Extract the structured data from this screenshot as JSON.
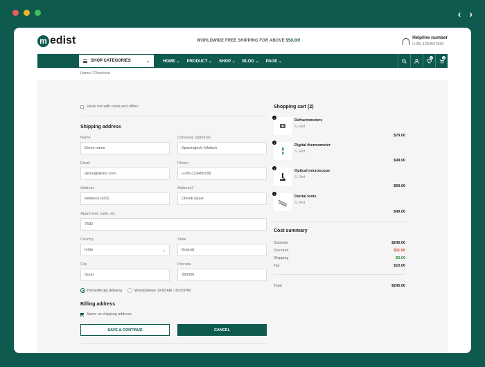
{
  "browser": {
    "prev": "‹",
    "next": "›"
  },
  "colors": {
    "brand": "#0e5a4e",
    "dot_red": "#e85c5c",
    "dot_yellow": "#f0b429",
    "dot_green": "#3dbd5a",
    "discount": "#d93a3a",
    "shipping": "#1a8a3c"
  },
  "header": {
    "logo_initial": "m",
    "logo_text": "edist",
    "promo_text": "WORLDWIDE FREE SHIPPING FOR ABOVE",
    "promo_amount": "$58.00!",
    "helpline_title": "Helpline number",
    "helpline_number": "(+00)-1234567890"
  },
  "nav": {
    "shop_categories": "SHOP CATEGORIES",
    "menu": [
      "HOME",
      "PRODUCT",
      "SHOP",
      "BLOG",
      "PAGE"
    ],
    "icons": [
      "search-icon",
      "user-icon",
      "heart-icon",
      "cart-icon"
    ],
    "wishlist_count": "0",
    "cart_count": "0"
  },
  "breadcrumb": "Home / Checkout",
  "checkout": {
    "newsletter_label": "Email me with news and offers",
    "shipping_title": "Shipping address",
    "fields": {
      "name": {
        "label": "Name",
        "value": "Demo name"
      },
      "company": {
        "label": "Company (optional)",
        "value": "Spacingtech Infotech"
      },
      "email": {
        "label": "Email",
        "value": "demo@demo.com"
      },
      "phone": {
        "label": "Phone",
        "value": "(+20)-123456789"
      },
      "address": {
        "label": "Address",
        "value": "Reliance GIDC"
      },
      "address2": {
        "label": "Address2",
        "value": "Chowk bazar"
      },
      "apartment": {
        "label": "Apartment, suite, etc",
        "value": "7582"
      },
      "country": {
        "label": "Country",
        "value": "India"
      },
      "state": {
        "label": "State",
        "value": "Gujarat"
      },
      "city": {
        "label": "City",
        "value": "Surat"
      },
      "pincode": {
        "label": "Pincode",
        "value": "395006"
      }
    },
    "delivery_home": "Home(All day delivery)",
    "delivery_work": "Work(Delivery 10:00 AM - 05:00 PM)",
    "billing_title": "Billing address",
    "billing_same": "Same as shipping address",
    "save_button": "SAVE & CONTINUE",
    "cancel_button": "CANCEL"
  },
  "cart": {
    "title": "Shopping cart (2)",
    "items": [
      {
        "qty": "1",
        "name": "Refractometers",
        "variant": "S, Red",
        "price": "$79.00"
      },
      {
        "qty": "1",
        "name": "Digital thermometer",
        "variant": "S, Red",
        "price": "$49.00"
      },
      {
        "qty": "1",
        "name": "Optical microscope",
        "variant": "S, Red",
        "price": "$69.00"
      },
      {
        "qty": "1",
        "name": "Dental tools",
        "variant": "S, Red",
        "price": "$49.00"
      }
    ]
  },
  "summary": {
    "title": "Cost summary",
    "subtotal_label": "Subtotal",
    "subtotal": "$245.00",
    "discount_label": "Discount",
    "discount": "$11.00",
    "shipping_label": "Shipping",
    "shipping": "$0.00",
    "tax_label": "Tax",
    "tax": "$10.00",
    "total_label": "Total",
    "total": "$245.00"
  }
}
